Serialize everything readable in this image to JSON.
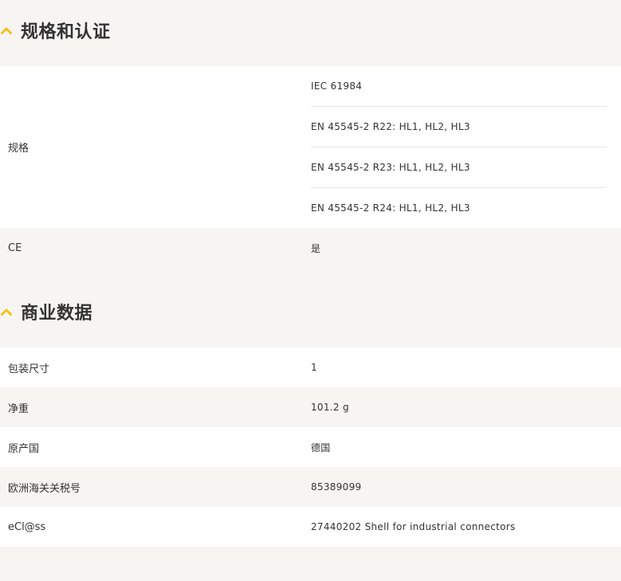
{
  "sections": [
    {
      "title": "规格和认证",
      "rows": [
        {
          "label": "规格",
          "values": [
            "IEC 61984",
            "EN 45545-2 R22: HL1, HL2, HL3",
            "EN 45545-2 R23: HL1, HL2, HL3",
            "EN 45545-2 R24: HL1, HL2, HL3"
          ]
        },
        {
          "label": "CE",
          "values": [
            "是"
          ]
        }
      ]
    },
    {
      "title": "商业数据",
      "rows": [
        {
          "label": "包装尺寸",
          "values": [
            "1"
          ]
        },
        {
          "label": "净重",
          "values": [
            "101.2 g"
          ]
        },
        {
          "label": "原产国",
          "values": [
            "德国"
          ]
        },
        {
          "label": "欧洲海关关税号",
          "values": [
            "85389099"
          ]
        },
        {
          "label": "eCl@ss",
          "values": [
            "27440202 Shell for industrial connectors"
          ]
        }
      ]
    }
  ],
  "colors": {
    "accent": "#f3c21a",
    "page_bg": "#f6f5f2",
    "row_white": "#ffffff",
    "text": "#333333",
    "divider": "#e4e4e4"
  },
  "icons": {
    "section_toggle": "chevron-up-icon"
  }
}
